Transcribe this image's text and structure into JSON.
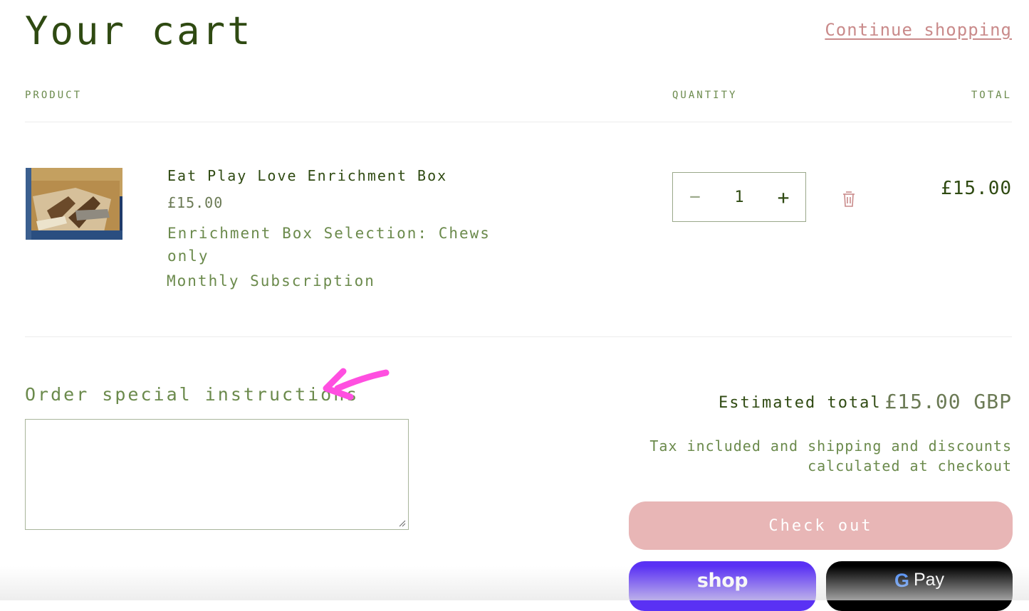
{
  "page": {
    "title": "Your cart",
    "continue_label": "Continue shopping"
  },
  "table": {
    "headers": {
      "product": "PRODUCT",
      "quantity": "QUANTITY",
      "total": "TOTAL"
    }
  },
  "item": {
    "name": "Eat Play Love Enrichment Box",
    "price": "£15.00",
    "option": "Enrichment Box Selection: Chews only",
    "subscription": "Monthly Subscription",
    "quantity": "1",
    "minus_label": "−",
    "plus_label": "+",
    "line_total": "£15.00",
    "image_icon": "product-photo-icon",
    "remove_icon": "trash-icon"
  },
  "instructions": {
    "label": "Order special instructions",
    "value": "",
    "annotation_icon": "pink-arrow-annotation-icon"
  },
  "summary": {
    "estimated_label": "Estimated total",
    "estimated_value": "£15.00 GBP",
    "tax_note": "Tax included and shipping and discounts calculated at checkout",
    "checkout_label": "Check out",
    "shop_pay_label": "shop",
    "gpay_g": "G",
    "gpay_label": "Pay"
  },
  "colors": {
    "primary_text": "#2f4a12",
    "secondary_text": "#6b8a4c",
    "link": "#c98a8a",
    "checkout_bg": "#e8b6b6",
    "shop_pay_bg": "#5a31f4",
    "gpay_bg": "#000000",
    "annotation": "#ff4fe0"
  }
}
